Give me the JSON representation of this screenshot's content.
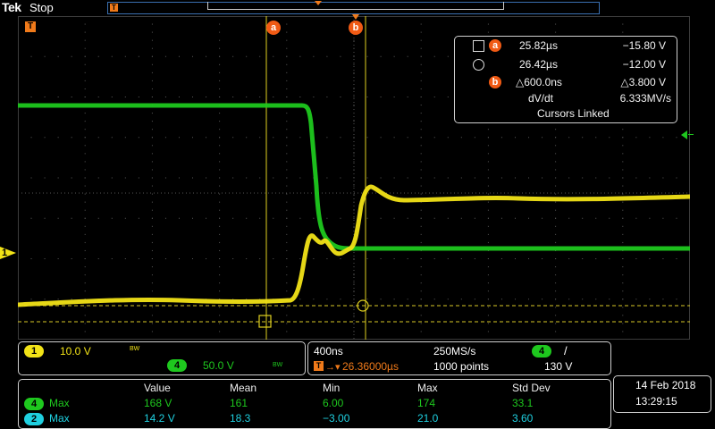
{
  "header": {
    "brand": "Tek",
    "run_state": "Stop"
  },
  "markers": {
    "cursor_a": "a",
    "cursor_b": "b",
    "trigger_T": "T",
    "channel1": "1"
  },
  "cursor_readout": {
    "row1": {
      "time": "25.82µs",
      "volts": "−15.80 V"
    },
    "row2": {
      "time": "26.42µs",
      "volts": "−12.00 V"
    },
    "delta": {
      "time": "△600.0ns",
      "volts": "△3.800 V"
    },
    "rate": {
      "label": "dV/dt",
      "value": "6.333MV/s"
    },
    "linked": "Cursors Linked"
  },
  "channels": {
    "ch1": {
      "num": "1",
      "scale": "10.0 V",
      "bw": "BW",
      "color": "#f2e317"
    },
    "ch4": {
      "num": "4",
      "scale": "50.0 V",
      "bw": "BW",
      "color": "#1ec81e"
    }
  },
  "timebase": {
    "scale": "400ns",
    "sample_rate": "250MS/s",
    "trigger_pos": "26.36000µs",
    "record_length": "1000 points",
    "trigger_channel": "4",
    "trigger_slope": "/",
    "trigger_level": "130 V"
  },
  "measurements": {
    "headers": [
      "Value",
      "Mean",
      "Min",
      "Max",
      "Std Dev"
    ],
    "rows": [
      {
        "ch": "4",
        "type": "Max",
        "color": "#1ec81e",
        "values": [
          "168 V",
          "161",
          "6.00",
          "174",
          "33.1"
        ]
      },
      {
        "ch": "2",
        "type": "Max",
        "color": "#1fd0e0",
        "values": [
          "14.2 V",
          "18.3",
          "−3.00",
          "21.0",
          "3.60"
        ]
      }
    ]
  },
  "datetime": {
    "date": "14 Feb  2018",
    "time": "13:29:15"
  },
  "colors": {
    "ch1": "#f2e317",
    "ch2": "#1fd0e0",
    "ch4": "#1ec81e",
    "trigger": "#f07a1a",
    "cursor_badge": "#f05a14",
    "record_bar": "#3a6fb0"
  }
}
